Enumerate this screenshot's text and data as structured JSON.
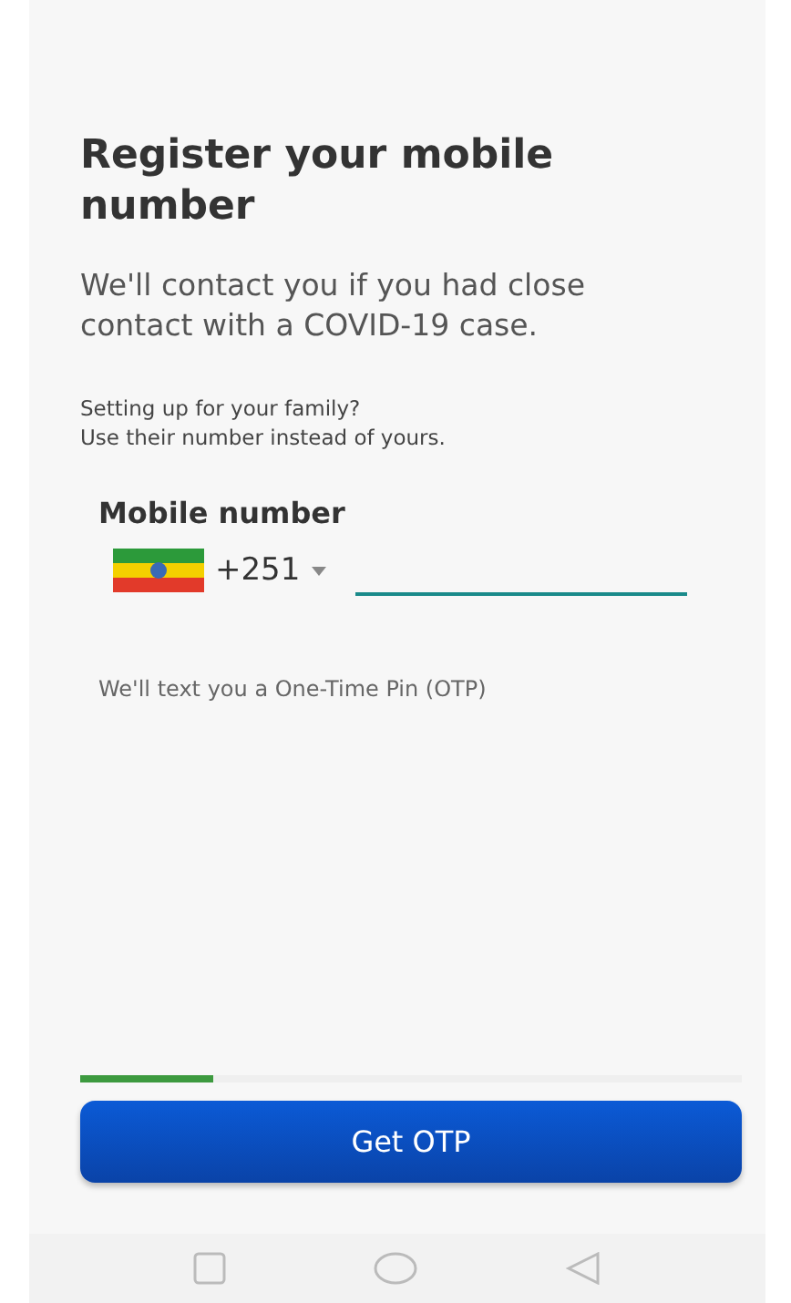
{
  "title": "Register your mobile number",
  "subtitle": "We'll contact you if you had close contact with a COVID-19 case.",
  "family_note": [
    "Setting up for your family?",
    "Use their number instead of yours."
  ],
  "phone": {
    "label": "Mobile number",
    "country_code": "+251"
  },
  "otp_note": "We'll text you a One-Time Pin (OTP)",
  "progress": {
    "level": 0.2
  },
  "button": "Get OTP"
}
